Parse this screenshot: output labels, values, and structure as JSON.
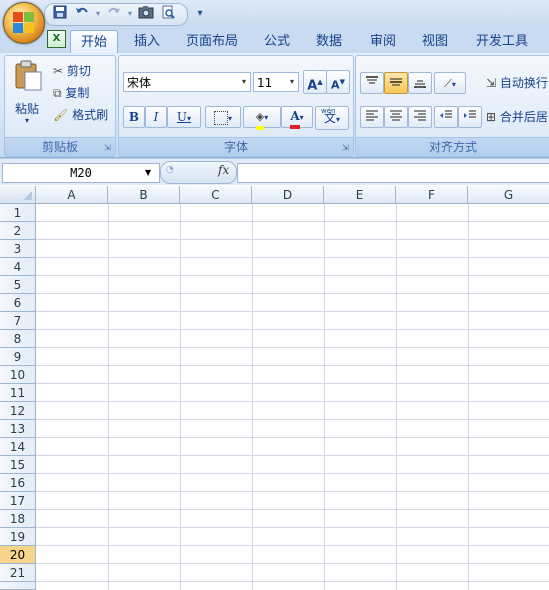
{
  "quick_access": {
    "items": [
      "save-icon",
      "undo-icon",
      "redo-icon",
      "camera-icon",
      "print-preview-icon",
      "customize-icon"
    ]
  },
  "tabs": [
    {
      "label": "开始",
      "active": true
    },
    {
      "label": "插入",
      "active": false
    },
    {
      "label": "页面布局",
      "active": false
    },
    {
      "label": "公式",
      "active": false
    },
    {
      "label": "数据",
      "active": false
    },
    {
      "label": "审阅",
      "active": false
    },
    {
      "label": "视图",
      "active": false
    },
    {
      "label": "开发工具",
      "active": false
    }
  ],
  "ribbon": {
    "clipboard": {
      "label": "剪贴板",
      "paste": "粘贴",
      "cut": "剪切",
      "copy": "复制",
      "format_painter": "格式刷"
    },
    "font": {
      "label": "字体",
      "font_name": "宋体",
      "font_size": "11",
      "bold": "B",
      "italic": "I",
      "underline": "U",
      "font_color_glyph": "A",
      "phonetic_glyph": "文",
      "phonetic_ruby": "wén"
    },
    "alignment": {
      "label": "对齐方式",
      "wrap_text": "自动换行",
      "merge_center": "合并后居"
    }
  },
  "formula_bar": {
    "name_box": "M20",
    "fx": "fx",
    "value": ""
  },
  "sheet": {
    "columns": [
      "A",
      "B",
      "C",
      "D",
      "E",
      "F",
      "G"
    ],
    "rows": [
      "1",
      "2",
      "3",
      "4",
      "5",
      "6",
      "7",
      "8",
      "9",
      "10",
      "11",
      "12",
      "13",
      "14",
      "15",
      "16",
      "17",
      "18",
      "19",
      "20",
      "21"
    ],
    "selected_row": "20"
  },
  "colors": {
    "accent": "#15428b",
    "ribbon_bg": "#dfeaf8",
    "selected_row_header": "#f8d58b",
    "gridline": "#d0d7e5"
  }
}
